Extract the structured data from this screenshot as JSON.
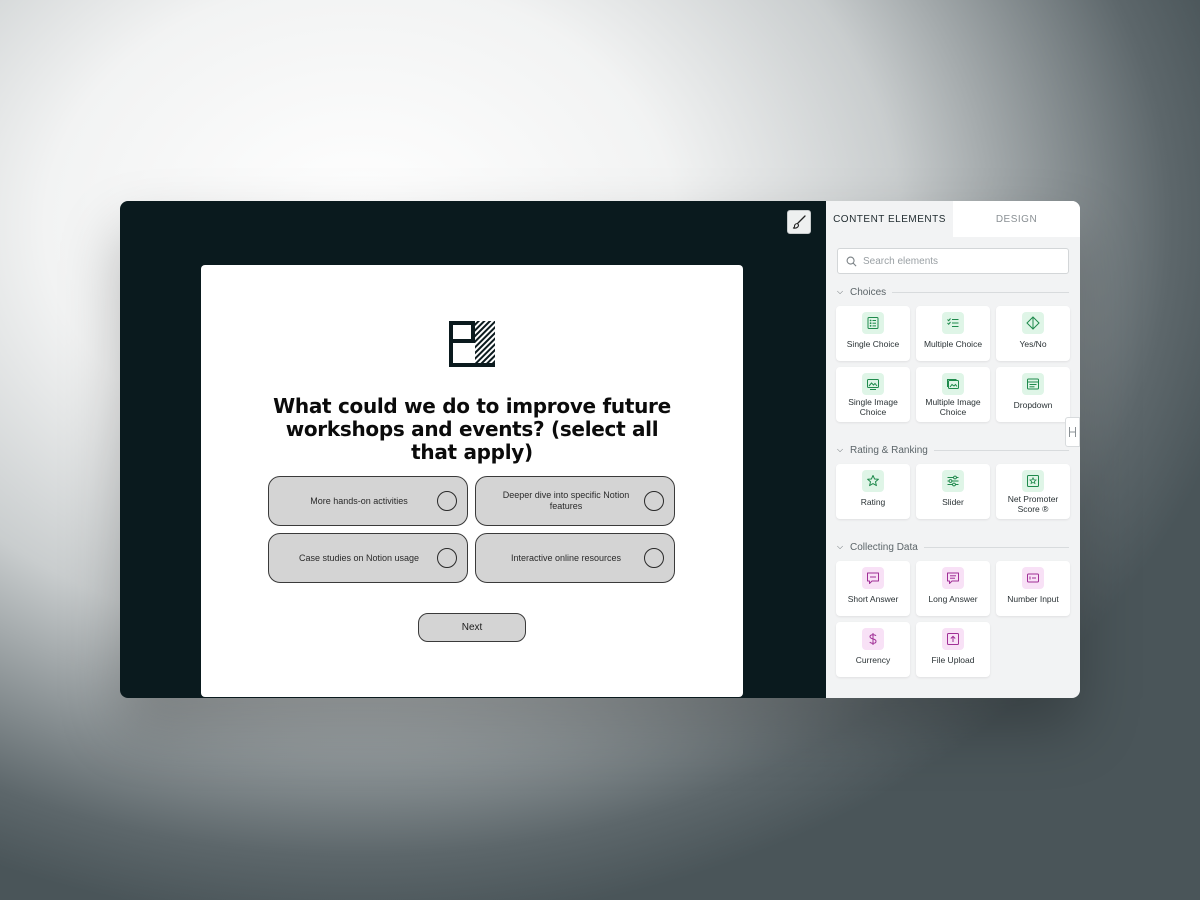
{
  "canvas": {
    "brush_icon": "paintbrush-icon",
    "logo_icon": "brand-logo",
    "question": "What could we do to improve future workshops and events? (select all that apply)",
    "options": [
      {
        "label": "More hands-on activities"
      },
      {
        "label": "Deeper dive into specific Notion features"
      },
      {
        "label": "Case studies on Notion usage"
      },
      {
        "label": "Interactive online resources"
      }
    ],
    "next_label": "Next"
  },
  "panel": {
    "tabs": [
      {
        "label": "CONTENT ELEMENTS",
        "active": true
      },
      {
        "label": "DESIGN",
        "active": false
      }
    ],
    "search": {
      "placeholder": "Search elements",
      "value": ""
    },
    "sections": [
      {
        "title": "Choices",
        "items": [
          {
            "label": "Single Choice",
            "icon": "single-choice-icon"
          },
          {
            "label": "Multiple Choice",
            "icon": "multiple-choice-icon"
          },
          {
            "label": "Yes/No",
            "icon": "yes-no-icon"
          },
          {
            "label": "Single Image Choice",
            "icon": "image-icon"
          },
          {
            "label": "Multiple Image Choice",
            "icon": "images-icon"
          },
          {
            "label": "Dropdown",
            "icon": "dropdown-icon"
          }
        ]
      },
      {
        "title": "Rating & Ranking",
        "items": [
          {
            "label": "Rating",
            "icon": "star-icon"
          },
          {
            "label": "Slider",
            "icon": "slider-icon"
          },
          {
            "label": "Net Promoter Score ®",
            "icon": "nps-icon"
          }
        ]
      },
      {
        "title": "Collecting Data",
        "items": [
          {
            "label": "Short Answer",
            "icon": "short-answer-icon"
          },
          {
            "label": "Long Answer",
            "icon": "long-answer-icon"
          },
          {
            "label": "Number Input",
            "icon": "number-input-icon"
          },
          {
            "label": "Currency",
            "icon": "dollar-icon"
          },
          {
            "label": "File Upload",
            "icon": "upload-icon"
          }
        ]
      }
    ],
    "colors": {
      "choice_icon_bg": "#dff5e7",
      "choice_icon_fg": "#1f8a4c",
      "data_icon_bg": "#f8e1f6",
      "data_icon_fg": "#a02f96"
    }
  }
}
